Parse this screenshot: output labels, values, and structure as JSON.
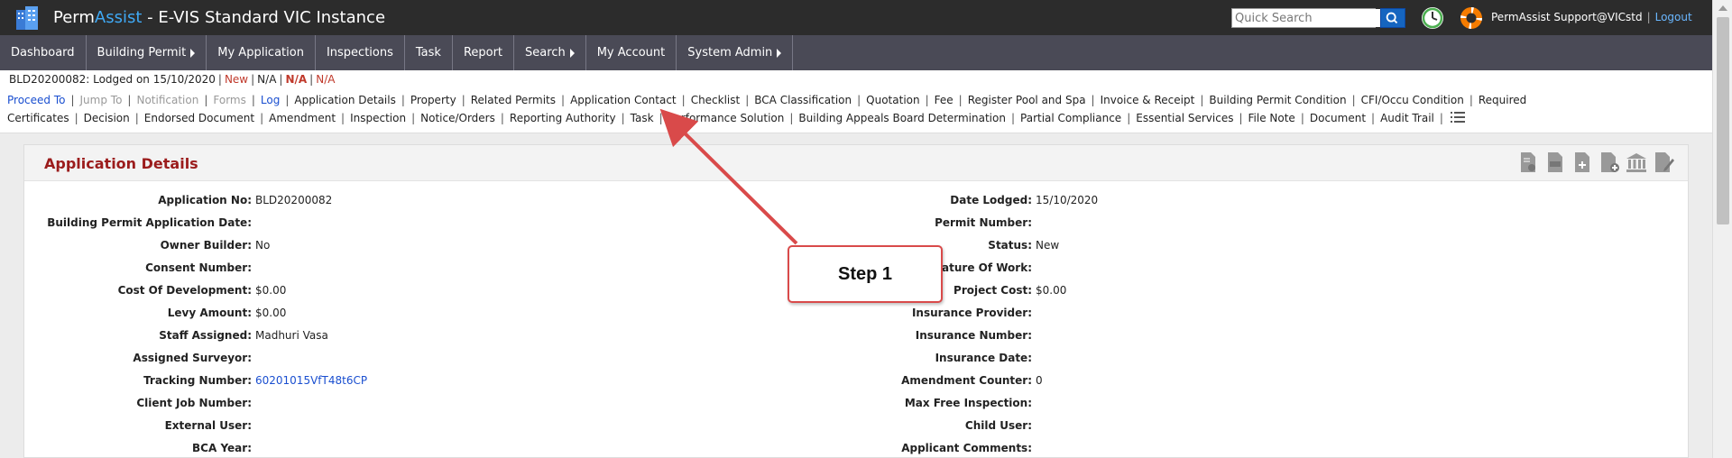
{
  "header": {
    "brand_part1": "Perm",
    "brand_part2": "Assist",
    "brand_part3": " - E-VIS Standard VIC Instance",
    "search_placeholder": "Quick Search",
    "user_label": "PermAssist Support@VICstd",
    "logout_label": "Logout"
  },
  "nav": {
    "items": [
      {
        "label": "Dashboard",
        "submenu": false
      },
      {
        "label": "Building Permit",
        "submenu": true
      },
      {
        "label": "My Application",
        "submenu": false
      },
      {
        "label": "Inspections",
        "submenu": false
      },
      {
        "label": "Task",
        "submenu": false
      },
      {
        "label": "Report",
        "submenu": false
      },
      {
        "label": "Search",
        "submenu": true
      },
      {
        "label": "My Account",
        "submenu": false
      },
      {
        "label": "System Admin",
        "submenu": true
      }
    ]
  },
  "status": {
    "app_text": "BLD20200082: Lodged on 15/10/2020",
    "status_new": "New",
    "na1": "N/A",
    "na2": "N/A",
    "na3": "N/A"
  },
  "sublinks": [
    {
      "label": "Proceed To",
      "style": "blue"
    },
    {
      "label": "Jump To",
      "style": "grey"
    },
    {
      "label": "Notification",
      "style": "grey"
    },
    {
      "label": "Forms",
      "style": "grey"
    },
    {
      "label": "Log",
      "style": "blue"
    },
    {
      "label": "Application Details",
      "style": "normal"
    },
    {
      "label": "Property",
      "style": "normal"
    },
    {
      "label": "Related Permits",
      "style": "normal"
    },
    {
      "label": "Application Contact",
      "style": "normal"
    },
    {
      "label": "Checklist",
      "style": "normal"
    },
    {
      "label": "BCA Classification",
      "style": "normal"
    },
    {
      "label": "Quotation",
      "style": "normal"
    },
    {
      "label": "Fee",
      "style": "normal"
    },
    {
      "label": "Register Pool and Spa",
      "style": "normal"
    },
    {
      "label": "Invoice & Receipt",
      "style": "normal"
    },
    {
      "label": "Building Permit Condition",
      "style": "normal"
    },
    {
      "label": "CFI/Occu Condition",
      "style": "normal"
    },
    {
      "label": "Required Certificates",
      "style": "normal"
    },
    {
      "label": "Decision",
      "style": "normal"
    },
    {
      "label": "Endorsed Document",
      "style": "normal"
    },
    {
      "label": "Amendment",
      "style": "normal"
    },
    {
      "label": "Inspection",
      "style": "normal"
    },
    {
      "label": "Notice/Orders",
      "style": "normal"
    },
    {
      "label": "Reporting Authority",
      "style": "normal"
    },
    {
      "label": "Task",
      "style": "normal"
    },
    {
      "label": "Performance Solution",
      "style": "normal"
    },
    {
      "label": "Building Appeals Board Determination",
      "style": "normal"
    },
    {
      "label": "Partial Compliance",
      "style": "normal"
    },
    {
      "label": "Essential Services",
      "style": "normal"
    },
    {
      "label": "File Note",
      "style": "normal"
    },
    {
      "label": "Document",
      "style": "normal"
    },
    {
      "label": "Audit Trail",
      "style": "normal"
    }
  ],
  "panel": {
    "title": "Application Details",
    "left_fields": [
      {
        "label": "Application No:",
        "value": "BLD20200082"
      },
      {
        "label": "Building Permit Application Date:",
        "value": ""
      },
      {
        "label": "Owner Builder:",
        "value": "No"
      },
      {
        "label": "Consent Number:",
        "value": ""
      },
      {
        "label": "Cost Of Development:",
        "value": "$0.00"
      },
      {
        "label": "Levy Amount:",
        "value": "$0.00"
      },
      {
        "label": "Staff Assigned:",
        "value": "Madhuri Vasa"
      },
      {
        "label": "Assigned Surveyor:",
        "value": ""
      },
      {
        "label": "Tracking Number:",
        "value": "60201015VfT48t6CP",
        "link": true
      },
      {
        "label": "Client Job Number:",
        "value": ""
      },
      {
        "label": "External User:",
        "value": ""
      },
      {
        "label": "BCA Year:",
        "value": ""
      }
    ],
    "right_fields": [
      {
        "label": "Date Lodged:",
        "value": "15/10/2020"
      },
      {
        "label": "Permit Number:",
        "value": ""
      },
      {
        "label": "Status:",
        "value": "New"
      },
      {
        "label": "Nature Of Work:",
        "value": ""
      },
      {
        "label": "Project Cost:",
        "value": "$0.00"
      },
      {
        "label": "Insurance Provider:",
        "value": ""
      },
      {
        "label": "Insurance Number:",
        "value": ""
      },
      {
        "label": "Insurance Date:",
        "value": ""
      },
      {
        "label": "Amendment Counter:",
        "value": "0"
      },
      {
        "label": "Max Free Inspection:",
        "value": ""
      },
      {
        "label": "Child User:",
        "value": ""
      },
      {
        "label": "Applicant Comments:",
        "value": ""
      }
    ],
    "tool_icons": [
      "certificate-doc-icon",
      "pdf-doc-icon",
      "add-doc-icon",
      "add-doc-plus-icon",
      "bank-icon",
      "edit-doc-icon"
    ]
  },
  "annotation": {
    "callout_text": "Step 1",
    "color": "#d94a4a"
  },
  "colors": {
    "topbar": "#2c2c2c",
    "nav": "#4a4a56",
    "brand_accent": "#3fa9f5",
    "panel_title": "#9b1c1c",
    "link": "#1a4fd0"
  }
}
